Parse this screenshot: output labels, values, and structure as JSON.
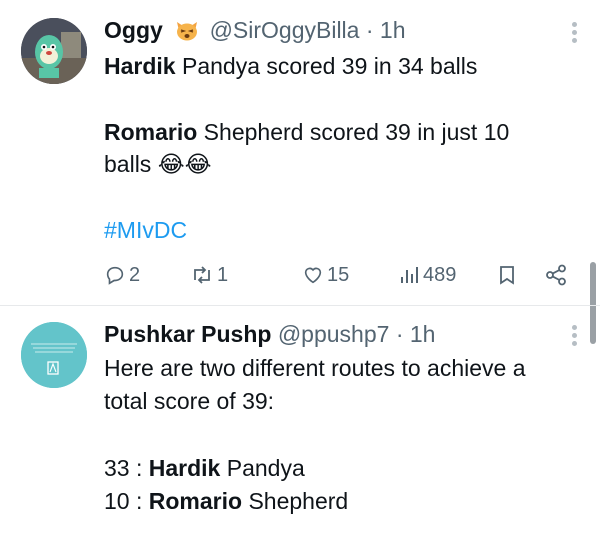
{
  "tweets": [
    {
      "display_name": "Oggy",
      "handle": "@SirOggyBilla",
      "time": "· 1h",
      "lines": [
        {
          "bold": "Hardik",
          "rest": " Pandya scored 39 in 34 balls"
        },
        {
          "bold": "Romario",
          "rest": " Shepherd scored 39 in just 10"
        },
        {
          "bold": "",
          "rest": "balls"
        }
      ],
      "emoji_line_suffix": "😂😂",
      "hashtag": "#MIvDC",
      "actions": {
        "replies": "2",
        "reposts": "1",
        "likes": "15",
        "views": "489"
      }
    },
    {
      "display_name": "Pushkar Pushp",
      "handle": "@ppushp7",
      "time": "· 1h",
      "lines": [
        "Here are two different routes to achieve a",
        "total score of 39:"
      ],
      "routes": [
        {
          "score": "33 : ",
          "bold": "Hardik",
          "rest": " Pandya"
        },
        {
          "score": "10 : ",
          "bold": "Romario",
          "rest": " Shepherd"
        }
      ]
    }
  ],
  "colors": {
    "text": "#0f1419",
    "secondary": "#536471",
    "link": "#1d9bf0"
  },
  "icons": [
    "cat-emoji-icon",
    "more-icon",
    "reply-icon",
    "repost-icon",
    "like-icon",
    "views-icon",
    "bookmark-icon",
    "share-icon"
  ]
}
